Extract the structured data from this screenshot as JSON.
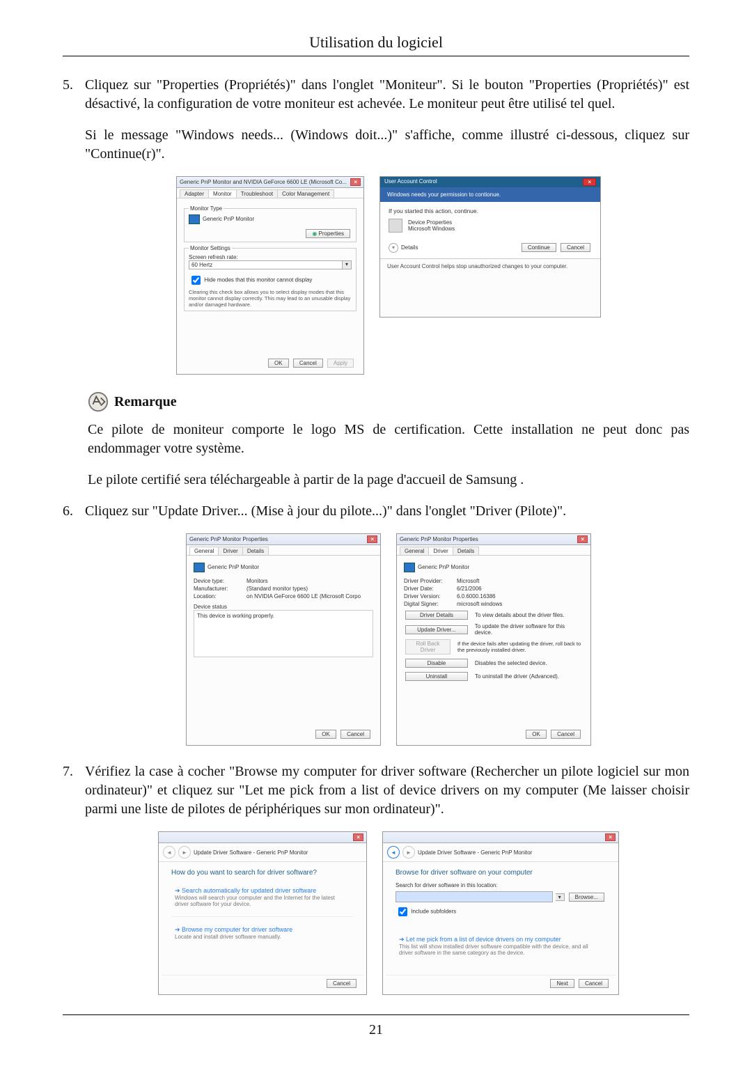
{
  "header": {
    "title": "Utilisation du logiciel"
  },
  "page_number": "21",
  "steps": {
    "s5": {
      "num": "5.",
      "p1": "Cliquez sur \"Properties (Propriétés)\" dans l'onglet \"Moniteur\". Si le bouton \"Properties (Propriétés)\" est désactivé, la configuration de votre moniteur est achevée. Le moniteur peut être utilisé tel quel.",
      "p2": "Si le message \"Windows needs... (Windows doit...)\" s'affiche, comme illustré ci-dessous, cliquez sur \"Continue(r)\"."
    },
    "s6": {
      "num": "6.",
      "p1": "Cliquez sur \"Update Driver... (Mise à jour du pilote...)\" dans l'onglet \"Driver (Pilote)\"."
    },
    "s7": {
      "num": "7.",
      "p1": "Vérifiez la case à cocher \"Browse my computer for driver software (Rechercher un pilote logiciel sur mon ordinateur)\" et cliquez sur \"Let me pick from a list of device drivers on my computer (Me laisser choisir parmi une liste de pilotes de périphériques sur mon ordinateur)\"."
    }
  },
  "remarque": {
    "label": "Remarque",
    "p1": "Ce pilote de moniteur comporte le logo MS de certification. Cette installation ne peut donc pas endommager votre système.",
    "p2": "Le pilote certifié sera téléchargeable à partir de la page d'accueil de Samsung ."
  },
  "shotA": {
    "title": "Generic PnP Monitor and NVIDIA GeForce 6600 LE (Microsoft Co...",
    "tabs": {
      "adapter": "Adapter",
      "monitor": "Monitor",
      "troubleshoot": "Troubleshoot",
      "color": "Color Management"
    },
    "monitorTypeLegend": "Monitor Type",
    "monitorName": "Generic PnP Monitor",
    "propertiesBtn": "Properties",
    "monitorSettingsLegend": "Monitor Settings",
    "refreshLabel": "Screen refresh rate:",
    "refreshValue": "60 Hertz",
    "hideModes": "Hide modes that this monitor cannot display",
    "hideModesNote": "Clearing this check box allows you to select display modes that this monitor cannot display correctly. This may lead to an unusable display and/or damaged hardware.",
    "ok": "OK",
    "cancel": "Cancel",
    "apply": "Apply"
  },
  "uac": {
    "title": "User Account Control",
    "band": "Windows needs your permission to contionue.",
    "started": "If you started this action, continue.",
    "item1": "Device Properties",
    "item2": "Microsoft Windows",
    "details": "Details",
    "continue": "Continue",
    "cancel": "Cancel",
    "footer": "User Account Control helps stop unauthorized changes to your computer."
  },
  "shotGeneral": {
    "title": "Generic PnP Monitor Properties",
    "tabs": {
      "general": "General",
      "driver": "Driver",
      "details": "Details"
    },
    "name": "Generic PnP Monitor",
    "deviceType_k": "Device type:",
    "deviceType_v": "Monitors",
    "manufacturer_k": "Manufacturer:",
    "manufacturer_v": "(Standard monitor types)",
    "location_k": "Location:",
    "location_v": "on NVIDIA GeForce 6600 LE (Microsoft Corpo",
    "statusLegend": "Device status",
    "statusText": "This device is working properly.",
    "ok": "OK",
    "cancel": "Cancel"
  },
  "shotDriver": {
    "title": "Generic PnP Monitor Properties",
    "tabs": {
      "general": "General",
      "driver": "Driver",
      "details": "Details"
    },
    "name": "Generic PnP Monitor",
    "provider_k": "Driver Provider:",
    "provider_v": "Microsoft",
    "date_k": "Driver Date:",
    "date_v": "6/21/2006",
    "version_k": "Driver Version:",
    "version_v": "6.0.6000.16386",
    "signer_k": "Digital Signer:",
    "signer_v": "microsoft windows",
    "btn_details": "Driver Details",
    "btn_details_d": "To view details about the driver files.",
    "btn_update": "Update Driver...",
    "btn_update_d": "To update the driver software for this device.",
    "btn_rollback": "Roll Back Driver",
    "btn_rollback_d": "If the device fails after updating the driver, roll back to the previously installed driver.",
    "btn_disable": "Disable",
    "btn_disable_d": "Disables the selected device.",
    "btn_uninstall": "Uninstall",
    "btn_uninstall_d": "To uninstall the driver (Advanced).",
    "ok": "OK",
    "cancel": "Cancel"
  },
  "wizA": {
    "breadcrumb": "Update Driver Software - Generic PnP Monitor",
    "heading": "How do you want to search for driver software?",
    "opt1_t": "Search automatically for updated driver software",
    "opt1_d": "Windows will search your computer and the Internet for the latest driver software for your device.",
    "opt2_t": "Browse my computer for driver software",
    "opt2_d": "Locate and install driver software manually.",
    "cancel": "Cancel"
  },
  "wizB": {
    "breadcrumb": "Update Driver Software - Generic PnP Monitor",
    "heading": "Browse for driver software on your computer",
    "searchLabel": "Search for driver software in this location:",
    "browse": "Browse...",
    "include": "Include subfolders",
    "opt_t": "Let me pick from a list of device drivers on my computer",
    "opt_d": "This list will show installed driver software compatible with the device, and all driver software in the same category as the device.",
    "next": "Next",
    "cancel": "Cancel"
  }
}
